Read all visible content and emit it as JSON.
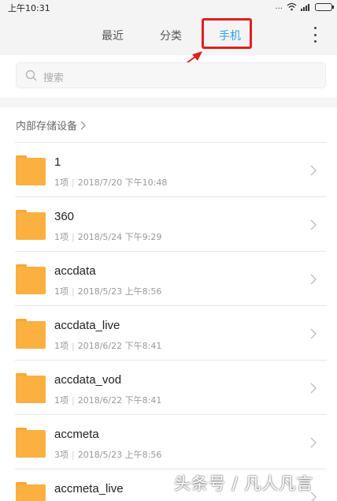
{
  "statusbar": {
    "time": "上午10:31",
    "signal_dots": "...",
    "wifi_icon": "wifi-icon",
    "cell_icon": "signal-icon"
  },
  "header": {
    "tabs": [
      {
        "label": "最近"
      },
      {
        "label": "分类"
      },
      {
        "label": "手机",
        "active": true
      }
    ],
    "more_icon": "more-vertical-icon",
    "annotation_color": "#e01f1f",
    "accent_color": "#2f9ee8"
  },
  "search": {
    "placeholder": "搜索",
    "icon": "search-icon"
  },
  "breadcrumb": {
    "label": "内部存储设备"
  },
  "folders": [
    {
      "name": "1",
      "count": "1项",
      "date": "2018/7/20 下午10:48"
    },
    {
      "name": "360",
      "count": "1项",
      "date": "2018/5/24 下午9:29"
    },
    {
      "name": "accdata",
      "count": "1项",
      "date": "2018/5/23 上午8:56"
    },
    {
      "name": "accdata_live",
      "count": "1项",
      "date": "2018/6/22 下午8:41"
    },
    {
      "name": "accdata_vod",
      "count": "1项",
      "date": "2018/6/22 下午8:41"
    },
    {
      "name": "accmeta",
      "count": "3项",
      "date": "2018/5/23 上午8:56"
    },
    {
      "name": "accmeta_live",
      "count": "",
      "date": ""
    }
  ],
  "folder_color": "#fbb040",
  "watermark": "头条号 / 凡人凡言"
}
